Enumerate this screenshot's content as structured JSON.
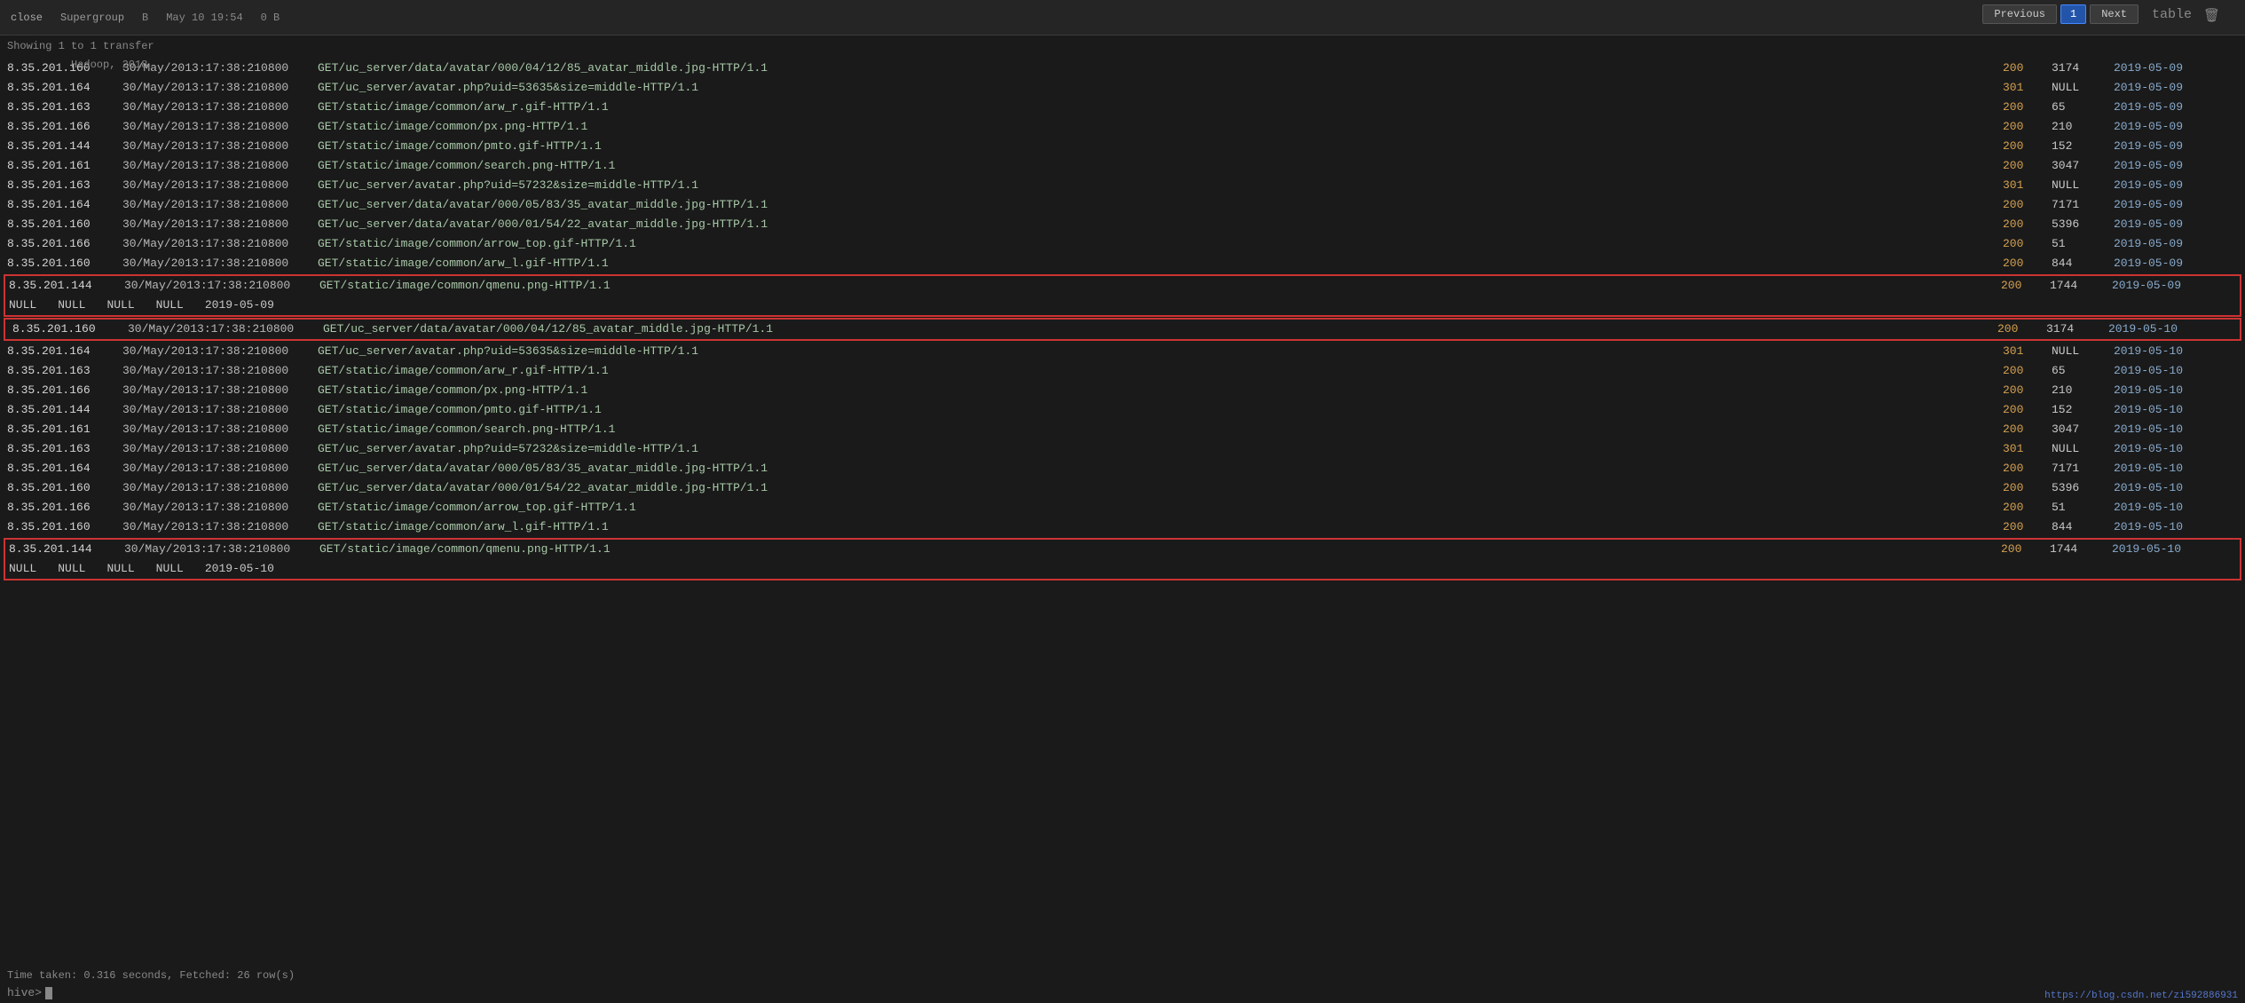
{
  "toolbar": {
    "items": [
      "close",
      "Supergroup",
      "B",
      "May 10 19:54",
      "0 B",
      "table"
    ],
    "trash_icon": "🗑",
    "showing_label": "Showing 1 to 1 transfer",
    "hadoop_label": "Hadoop, 2018"
  },
  "pagination": {
    "previous_label": "Previous",
    "page_number": "1",
    "next_label": "Next"
  },
  "rows": [
    {
      "ip": "8.35.201.160",
      "date": "30/May/2013:17:38:210800",
      "request": "GET/uc_server/data/avatar/000/04/12/85_avatar_middle.jpg-HTTP/1.1",
      "status": "200",
      "size": "3174",
      "logdate": "2019-05-09"
    },
    {
      "ip": "8.35.201.164",
      "date": "30/May/2013:17:38:210800",
      "request": "GET/uc_server/avatar.php?uid=53635&size=middle-HTTP/1.1",
      "status": "301",
      "size": "NULL",
      "logdate": "2019-05-09"
    },
    {
      "ip": "8.35.201.163",
      "date": "30/May/2013:17:38:210800",
      "request": "GET/static/image/common/arw_r.gif-HTTP/1.1",
      "status": "200",
      "size": "65",
      "logdate": "2019-05-09"
    },
    {
      "ip": "8.35.201.166",
      "date": "30/May/2013:17:38:210800",
      "request": "GET/static/image/common/px.png-HTTP/1.1",
      "status": "200",
      "size": "210",
      "logdate": "2019-05-09"
    },
    {
      "ip": "8.35.201.144",
      "date": "30/May/2013:17:38:210800",
      "request": "GET/static/image/common/pmto.gif-HTTP/1.1",
      "status": "200",
      "size": "152",
      "logdate": "2019-05-09"
    },
    {
      "ip": "8.35.201.161",
      "date": "30/May/2013:17:38:210800",
      "request": "GET/static/image/common/search.png-HTTP/1.1",
      "status": "200",
      "size": "3047",
      "logdate": "2019-05-09"
    },
    {
      "ip": "8.35.201.163",
      "date": "30/May/2013:17:38:210800",
      "request": "GET/uc_server/avatar.php?uid=57232&size=middle-HTTP/1.1",
      "status": "301",
      "size": "NULL",
      "logdate": "2019-05-09"
    },
    {
      "ip": "8.35.201.164",
      "date": "30/May/2013:17:38:210800",
      "request": "GET/uc_server/data/avatar/000/05/83/35_avatar_middle.jpg-HTTP/1.1",
      "status": "200",
      "size": "7171",
      "logdate": "2019-05-09"
    },
    {
      "ip": "8.35.201.160",
      "date": "30/May/2013:17:38:210800",
      "request": "GET/uc_server/data/avatar/000/01/54/22_avatar_middle.jpg-HTTP/1.1",
      "status": "200",
      "size": "5396",
      "logdate": "2019-05-09"
    },
    {
      "ip": "8.35.201.166",
      "date": "30/May/2013:17:38:210800",
      "request": "GET/static/image/common/arrow_top.gif-HTTP/1.1",
      "status": "200",
      "size": "51",
      "logdate": "2019-05-09"
    },
    {
      "ip": "8.35.201.160",
      "date": "30/May/2013:17:38:210800",
      "request": "GET/static/image/common/arw_l.gif-HTTP/1.1",
      "status": "200",
      "size": "844",
      "logdate": "2019-05-09"
    },
    {
      "ip": "8.35.201.144",
      "date": "30/May/2013:17:38:210800",
      "request": "GET/static/image/common/qmenu.png-HTTP/1.1",
      "status": "200",
      "size": "1744",
      "logdate": "2019-05-09"
    },
    {
      "ip": "8.35.201.160",
      "date": "30/May/2013:17:38:210800",
      "request": "GET/uc_server/data/avatar/000/04/12/85_avatar_middle.jpg-HTTP/1.1",
      "status": "200",
      "size": "3174",
      "logdate": "2019-05-10"
    },
    {
      "ip": "8.35.201.164",
      "date": "30/May/2013:17:38:210800",
      "request": "GET/uc_server/avatar.php?uid=53635&size=middle-HTTP/1.1",
      "status": "301",
      "size": "NULL",
      "logdate": "2019-05-10"
    },
    {
      "ip": "8.35.201.163",
      "date": "30/May/2013:17:38:210800",
      "request": "GET/static/image/common/arw_r.gif-HTTP/1.1",
      "status": "200",
      "size": "65",
      "logdate": "2019-05-10"
    },
    {
      "ip": "8.35.201.166",
      "date": "30/May/2013:17:38:210800",
      "request": "GET/static/image/common/px.png-HTTP/1.1",
      "status": "200",
      "size": "210",
      "logdate": "2019-05-10"
    },
    {
      "ip": "8.35.201.144",
      "date": "30/May/2013:17:38:210800",
      "request": "GET/static/image/common/pmto.gif-HTTP/1.1",
      "status": "200",
      "size": "152",
      "logdate": "2019-05-10"
    },
    {
      "ip": "8.35.201.161",
      "date": "30/May/2013:17:38:210800",
      "request": "GET/static/image/common/search.png-HTTP/1.1",
      "status": "200",
      "size": "3047",
      "logdate": "2019-05-10"
    },
    {
      "ip": "8.35.201.163",
      "date": "30/May/2013:17:38:210800",
      "request": "GET/uc_server/avatar.php?uid=57232&size=middle-HTTP/1.1",
      "status": "301",
      "size": "NULL",
      "logdate": "2019-05-10"
    },
    {
      "ip": "8.35.201.164",
      "date": "30/May/2013:17:38:210800",
      "request": "GET/uc_server/data/avatar/000/05/83/35_avatar_middle.jpg-HTTP/1.1",
      "status": "200",
      "size": "7171",
      "logdate": "2019-05-10"
    },
    {
      "ip": "8.35.201.160",
      "date": "30/May/2013:17:38:210800",
      "request": "GET/uc_server/data/avatar/000/01/54/22_avatar_middle.jpg-HTTP/1.1",
      "status": "200",
      "size": "5396",
      "logdate": "2019-05-10"
    },
    {
      "ip": "8.35.201.166",
      "date": "30/May/2013:17:38:210800",
      "request": "GET/static/image/common/arrow_top.gif-HTTP/1.1",
      "status": "200",
      "size": "51",
      "logdate": "2019-05-10"
    },
    {
      "ip": "8.35.201.160",
      "date": "30/May/2013:17:38:210800",
      "request": "GET/static/image/common/arw_l.gif-HTTP/1.1",
      "status": "200",
      "size": "844",
      "logdate": "2019-05-10"
    },
    {
      "ip": "8.35.201.144",
      "date": "30/May/2013:17:38:210800",
      "request": "GET/static/image/common/qmenu.png-HTTP/1.1",
      "status": "200",
      "size": "1744",
      "logdate": "2019-05-10"
    }
  ],
  "null_row_1": {
    "vals": [
      "NULL",
      "NULL",
      "NULL",
      "NULL",
      "2019-05-09"
    ]
  },
  "null_row_2": {
    "vals": [
      "NULL",
      "NULL",
      "NULL",
      "NULL",
      "2019-05-10"
    ]
  },
  "status": {
    "time_taken": "Time taken: 0.316 seconds, Fetched: 26 row(s)",
    "prompt": "hive>",
    "url": "https://blog.csdn.net/zi592886931"
  }
}
